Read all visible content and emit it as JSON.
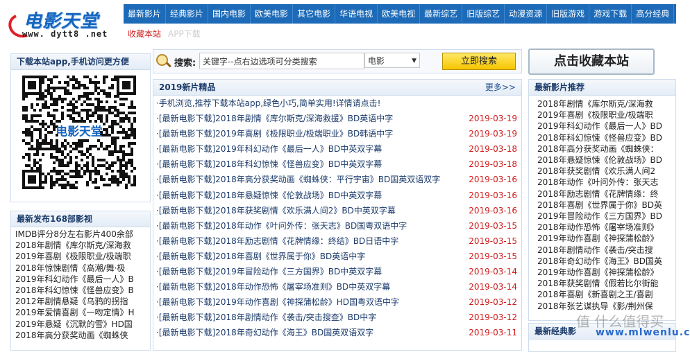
{
  "logo": {
    "brand": "电影天堂",
    "url": "www. dytt8 .net"
  },
  "topnav": [
    "最新影片",
    "经典影片",
    "国内电影",
    "欧美电影",
    "其它电影",
    "华语电视",
    "欧美电视",
    "最新综艺",
    "旧版综艺",
    "动漫资源",
    "旧版游戏",
    "游戏下载",
    "高分经典"
  ],
  "subnav": {
    "favorite": "收藏本站",
    "app": "APP下载"
  },
  "app_box": {
    "title": "下载本站app,手机访问更方便",
    "qr_caption": "电影天堂"
  },
  "search": {
    "label": "搜索:",
    "value": "关键字--点右边选项可分类搜索",
    "category": "电影",
    "button": "立即搜索"
  },
  "favorite_button": "点击收藏本站",
  "left168": {
    "title": "最新发布168部影视",
    "items": [
      "IMDB评分8分左右影片400余部",
      "2018年剧情《库尔斯克/深海救",
      "2019年喜剧《极限职业/极端职",
      "2018年惊悚剧情《高潮/舞·极",
      "2019年科幻动作《最后一人》B",
      "2018年科幻惊悚《怪兽应变》B",
      "2012年剧情悬疑《乌鸦的拐指",
      "2019年爱情喜剧《一吻定情》H",
      "2019年悬疑《沉默的雪》HD国",
      "2018年高分获奖动画《蜘蛛侠"
    ]
  },
  "main": {
    "title": "2019新片精品",
    "more": "更多>>",
    "notice": "·手机浏览,推荐下载本站app,绿色小巧,简单实用!详情请点击!",
    "items": [
      {
        "title": "·[最新电影下载]2018年剧情《库尔斯克/深海救援》BD英语中字",
        "date": "2019-03-19"
      },
      {
        "title": "·[最新电影下载]2019年喜剧《极限职业/极端职业》BD韩语中字",
        "date": "2019-03-19"
      },
      {
        "title": "·[最新电影下载]2019年科幻动作《最后一人》BD中英双字幕",
        "date": "2019-03-18"
      },
      {
        "title": "·[最新电影下载]2018年科幻惊悚《怪兽应变》BD中英双字幕",
        "date": "2019-03-18"
      },
      {
        "title": "·[最新电影下载]2018年高分获奖动画《蜘蛛侠：平行宇宙》BD国英双语双字",
        "date": "2019-03-16"
      },
      {
        "title": "·[最新电影下载]2018年悬疑惊悚《伦敦战场》BD中英双字幕",
        "date": "2019-03-16"
      },
      {
        "title": "·[最新电影下载]2018年获奖剧情《欢乐满人间2》BD中英双字幕",
        "date": "2019-03-16"
      },
      {
        "title": "·[最新电影下载]2018年动作《叶问外传：张天志》BD国粤双语中字",
        "date": "2019-03-15"
      },
      {
        "title": "·[最新电影下载]2018年励志剧情《花牌情缘：终结》BD日语中字",
        "date": "2019-03-15"
      },
      {
        "title": "·[最新电影下载]2018年喜剧《世界属于你》BD英语中字",
        "date": "2019-03-15"
      },
      {
        "title": "·[最新电影下载]2019年冒险动作《三方国界》BD中英双字幕",
        "date": "2019-03-14"
      },
      {
        "title": "·[最新电影下载]2018年动作恐怖《屠宰场准则》BD中英双字幕",
        "date": "2019-03-14"
      },
      {
        "title": "·[最新电影下载]2019年动作喜剧《神探蒲松龄》HD国粤双语中字",
        "date": "2019-03-12"
      },
      {
        "title": "·[最新电影下载]2018年剧情动作《袭击/突击搜查》BD中字",
        "date": "2019-03-12"
      },
      {
        "title": "·[最新电影下载]2018年奇幻动作《海王》BD国英双语双字",
        "date": "2019-03-11"
      }
    ]
  },
  "right": {
    "title": "最新影片推荐",
    "items": [
      "2018年剧情《库尔斯克/深海救",
      "2019年喜剧《极限职业/极端职",
      "2019年科幻动作《最后一人》BD",
      "2018年科幻惊悚《怪兽应变》BD",
      "2018年高分获奖动画《蜘蛛侠：",
      "2018年悬疑惊悚《伦敦战场》BD",
      "2018年获奖剧情《欢乐满人间2",
      "2018年动作《叶问外传：张天志",
      "2018年励志剧情《花牌情缘：终",
      "2018年喜剧《世界属于你》BD英",
      "2019年冒险动作《三方国界》BD",
      "2018年动作恐怖《屠宰场准则》",
      "2019年动作喜剧《神探蒲松龄》",
      "2018年剧情动作《袭击/突击搜",
      "2018年奇幻动作《海王》BD国英",
      "2019年动作喜剧《神探蒲松龄》",
      "2018年获奖剧情《假若比尔街能",
      "2018年喜剧《新喜剧之王/喜剧",
      "2018年张艺谋执导《影/荆州保"
    ],
    "bottom_title": "最新经典影"
  },
  "watermark": {
    "text": "值 什么值得买",
    "site": "www.mlwenlu.com"
  },
  "colors": {
    "nav_bg": "#1d6bb8",
    "date": "#d01a1a",
    "link": "#1a3a6a",
    "button": "#f6c500"
  }
}
